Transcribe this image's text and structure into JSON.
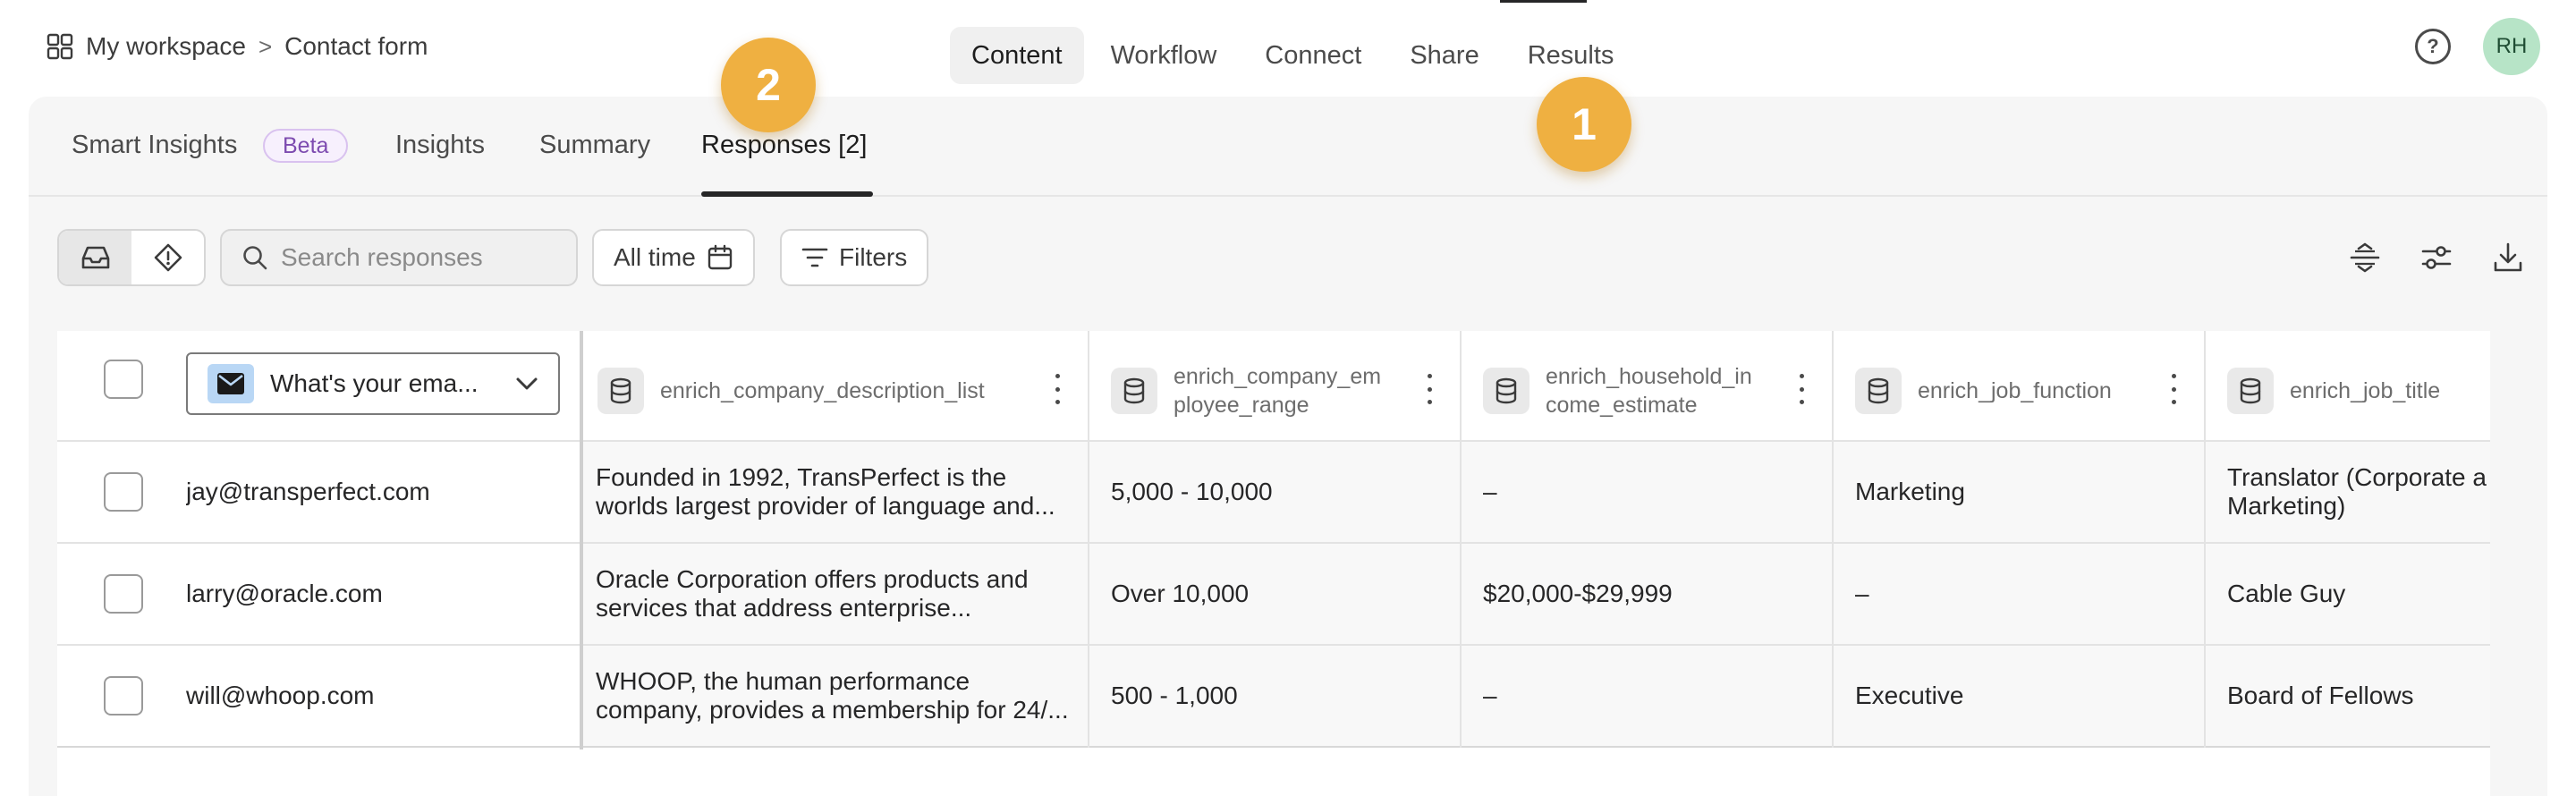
{
  "breadcrumb": {
    "workspace": "My workspace",
    "separator": ">",
    "form": "Contact form"
  },
  "top_nav": [
    {
      "label": "Content",
      "active": true
    },
    {
      "label": "Workflow",
      "active": false
    },
    {
      "label": "Connect",
      "active": false
    },
    {
      "label": "Share",
      "active": false
    },
    {
      "label": "Results",
      "active": false
    }
  ],
  "user": {
    "initials": "RH",
    "avatar_color": "#b7e4c7"
  },
  "help_icon_glyph": "?",
  "sub_tabs": [
    {
      "label": "Smart Insights",
      "badge": "Beta"
    },
    {
      "label": "Insights"
    },
    {
      "label": "Summary"
    },
    {
      "label": "Responses [2]",
      "active": true
    }
  ],
  "toolbar": {
    "search_placeholder": "Search responses",
    "date_filter": "All time",
    "filters_label": "Filters"
  },
  "table": {
    "question_selector": "What's your ema...",
    "columns": [
      "enrich_company_description_list",
      "enrich_company_em\nployee_range",
      "enrich_household_in\ncome_estimate",
      "enrich_job_function",
      "enrich_job_title"
    ],
    "rows": [
      {
        "email": "jay@transperfect.com",
        "desc_1": "Founded in 1992, TransPerfect is the",
        "desc_2": "worlds largest provider of language and...",
        "employees": "5,000 - 10,000",
        "income": "–",
        "job_function": "Marketing",
        "job_title_1": "Translator (Corporate a",
        "job_title_2": "Marketing)"
      },
      {
        "email": "larry@oracle.com",
        "desc_1": "Oracle Corporation offers products and",
        "desc_2": "services that address enterprise...",
        "employees": "Over 10,000",
        "income": "$20,000-$29,999",
        "job_function": "–",
        "job_title_1": "Cable Guy",
        "job_title_2": ""
      },
      {
        "email": "will@whoop.com",
        "desc_1": "WHOOP, the human performance",
        "desc_2": "company, provides a membership for 24/...",
        "employees": "500 - 1,000",
        "income": "–",
        "job_function": "Executive",
        "job_title_1": "Board of Fellows",
        "job_title_2": ""
      }
    ]
  },
  "annotations": {
    "step_1": "1",
    "step_2": "2",
    "color": "#efb041"
  }
}
